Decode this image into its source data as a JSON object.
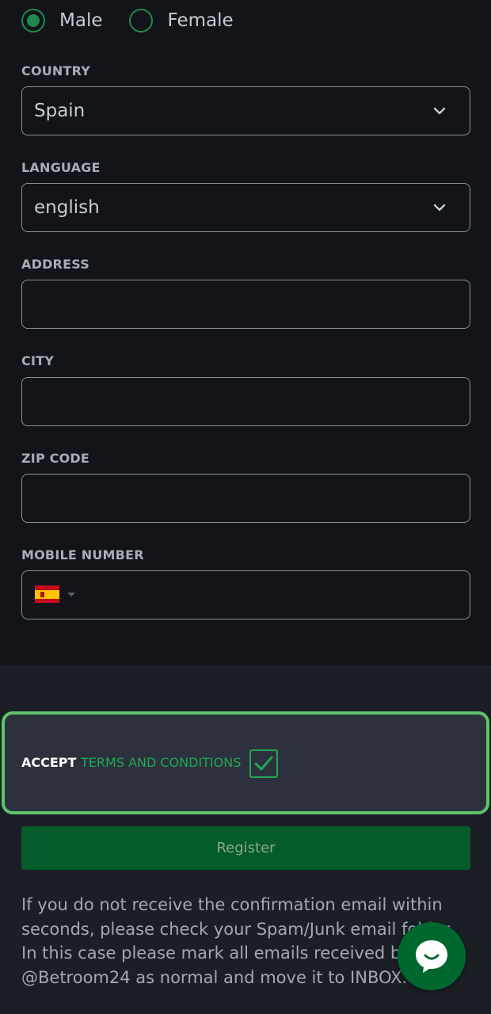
{
  "gender": {
    "options": [
      {
        "label": "Male",
        "selected": true
      },
      {
        "label": "Female",
        "selected": false
      }
    ]
  },
  "country": {
    "label": "COUNTRY",
    "value": "Spain"
  },
  "language": {
    "label": "LANGUAGE",
    "value": "english"
  },
  "address": {
    "label": "ADDRESS",
    "value": ""
  },
  "city": {
    "label": "CITY",
    "value": ""
  },
  "zip": {
    "label": "ZIP CODE",
    "value": ""
  },
  "mobile": {
    "label": "MOBILE NUMBER",
    "value": "",
    "flag_icon": "spain-flag-icon"
  },
  "terms": {
    "accept_word": "ACCEPT",
    "link_text": "TERMS AND CONDITIONS",
    "checked": true
  },
  "register": {
    "label": "Register"
  },
  "info": {
    "text": "If you do not receive the confirmation email within seconds, please check your Spam/Junk email folder. In this case please mark all emails received by @Betroom24 as normal and move it to INBOX."
  },
  "colors": {
    "accent": "#1fa855",
    "highlight_border": "#5ec46a",
    "button": "#045c2a",
    "background": "#12141a"
  },
  "icons": {
    "dropdown": "chevron-down-icon",
    "checkbox": "check-icon",
    "chat": "chat-icon"
  }
}
